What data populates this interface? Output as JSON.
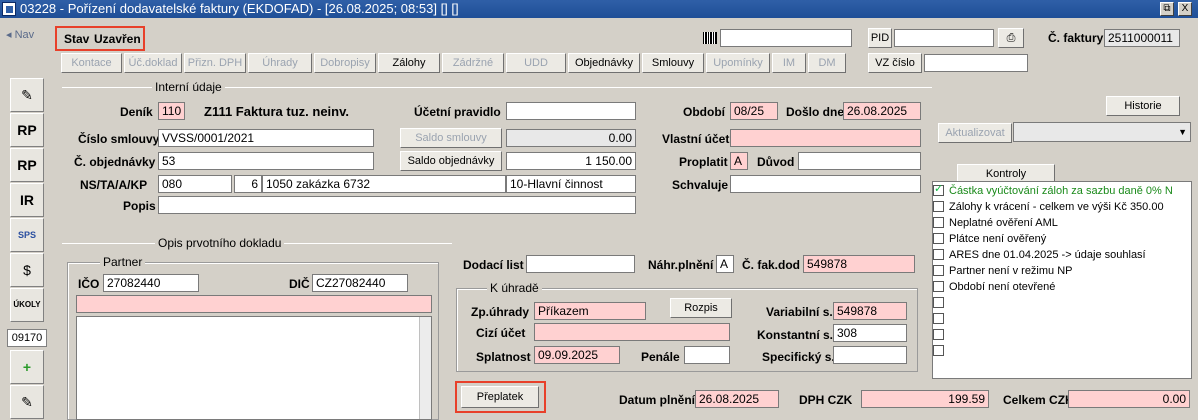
{
  "window": {
    "title": "03228 - Pořízení dodavatelské faktury (EKDOFAD) - [26.08.2025; 08:53] [] []",
    "close_label": "X",
    "restore_label": "⧉"
  },
  "nav": {
    "label": "Nav"
  },
  "status": {
    "label": "Stav",
    "value": "Uzavřen"
  },
  "barcode": {
    "value": ""
  },
  "pid": {
    "label": "PID",
    "value": ""
  },
  "invoice_number": {
    "label": "Č. faktury",
    "value": "2511000011"
  },
  "vz": {
    "label": "VZ číslo",
    "value": ""
  },
  "tabs": [
    "Kontace",
    "Úč.doklad",
    "Přizn. DPH",
    "Úhrady",
    "Dobropisy",
    "Zálohy",
    "Zádržné",
    "UDD",
    "Objednávky",
    "Smlouvy",
    "Upomínky",
    "IM",
    "DM"
  ],
  "sidebar": {
    "rp1": "RP",
    "rp2": "RP",
    "ir": "IR",
    "sps": "SPS",
    "ukoly": "ÚKOLY",
    "number": "09170"
  },
  "internal": {
    "section_title": "Interní údaje",
    "denik_label": "Deník",
    "denik_value": "110",
    "denik_desc": "Z111 Faktura tuz. neinv.",
    "ucetni_label": "Účetní pravidlo",
    "ucetni_value": "",
    "smlouva_label": "Číslo smlouvy",
    "smlouva_value": "VVSS/0001/2021",
    "saldo_smlouvy_label": "Saldo smlouvy",
    "saldo_smlouvy_value": "0.00",
    "objednavka_label": "Č. objednávky",
    "objednavka_value": "53",
    "saldo_obj_label": "Saldo objednávky",
    "saldo_obj_value": "1 150.00",
    "ns_label": "NS/TA/A/KP",
    "ns_value": "080",
    "ta_value": "6",
    "a_value": "1050 zakázka 6732",
    "kp_value": "10-Hlavní činnost",
    "popis_label": "Popis",
    "popis_value": ""
  },
  "right": {
    "obdobi_label": "Období",
    "obdobi_value": "08/25",
    "doslo_label": "Došlo dne",
    "doslo_value": "26.08.2025",
    "vlastni_label": "Vlastní účet",
    "vlastni_value": "",
    "proplatit_label": "Proplatit",
    "proplatit_value": "A",
    "duvod_label": "Důvod",
    "duvod_value": "",
    "schvaluje_label": "Schvaluje",
    "schvaluje_value": "",
    "historie": "Historie",
    "aktualizovat": "Aktualizovat",
    "kontroly": "Kontroly"
  },
  "checks": [
    {
      "text": "Částka vyúčtování záloh za sazbu daně 0% N",
      "checked": true
    },
    {
      "text": "Zálohy k vrácení - celkem ve výši Kč 350.00",
      "checked": false
    },
    {
      "text": "Neplatné ověření AML",
      "checked": false
    },
    {
      "text": "Plátce není ověřený",
      "checked": false
    },
    {
      "text": "ARES dne 01.04.2025 -> údaje souhlasí",
      "checked": false
    },
    {
      "text": "Partner není v režimu NP",
      "checked": false
    },
    {
      "text": "Období není otevřené",
      "checked": false
    },
    {
      "text": "",
      "checked": false
    },
    {
      "text": "",
      "checked": false
    },
    {
      "text": "",
      "checked": false
    },
    {
      "text": "",
      "checked": false
    }
  ],
  "opis": {
    "section_title": "Opis prvotního dokladu",
    "partner_title": "Partner",
    "ico_label": "IČO",
    "ico_value": "27082440",
    "dic_label": "DIČ",
    "dic_value": "CZ27082440",
    "partner_name": "",
    "dodaci_label": "Dodací list",
    "dodaci_value": "",
    "nahr_label": "Náhr.plnění",
    "nahr_value": "A",
    "cfak_label": "Č. fak.dod",
    "cfak_value": "549878"
  },
  "uhrada": {
    "title": "K úhradě",
    "zp_label": "Zp.úhrady",
    "zp_value": "Příkazem",
    "rozpis": "Rozpis",
    "cizi_label": "Cizí účet",
    "cizi_value": "",
    "splatnost_label": "Splatnost",
    "splatnost_value": "09.09.2025",
    "penale_label": "Penále",
    "penale_value": "",
    "vs_label": "Variabilní s.",
    "vs_value": "549878",
    "ks_label": "Konstantní s.",
    "ks_value": "308",
    "ss_label": "Specifický s.",
    "ss_value": ""
  },
  "bottom": {
    "preplatek": "Přeplatek",
    "datum_label": "Datum plnění",
    "datum_value": "26.08.2025",
    "dph_label": "DPH CZK",
    "dph_value": "199.59",
    "celkem_label": "Celkem CZK",
    "celkem_value": "0.00"
  }
}
